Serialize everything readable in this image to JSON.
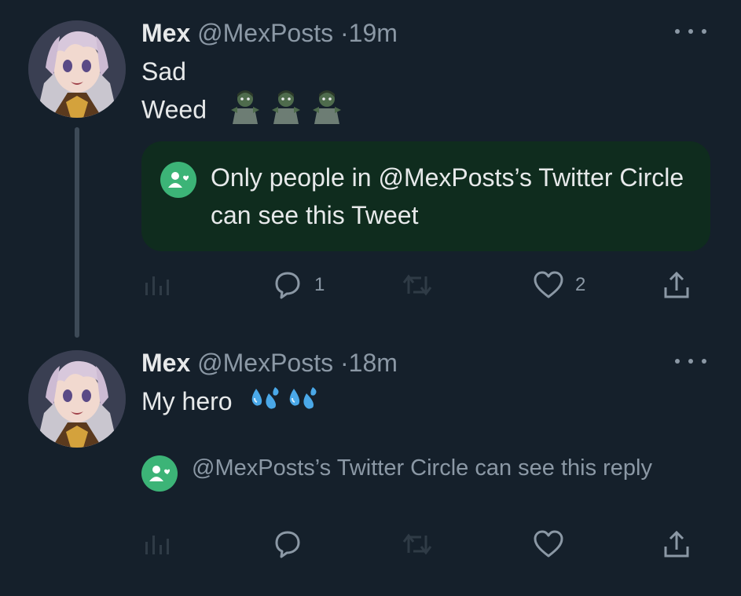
{
  "tweets": [
    {
      "name": "Mex",
      "handle": "@MexPosts",
      "separator": "·",
      "time": "19m",
      "lines": [
        "Sad",
        "Weed"
      ],
      "emoji": "zombie-emoji",
      "circle_notice": "Only people in @MexPosts’s Twitter Circle can see this Tweet",
      "actions": {
        "replies": "1",
        "retweets": "",
        "likes": "2"
      }
    },
    {
      "name": "Mex",
      "handle": "@MexPosts",
      "separator": "·",
      "time": "18m",
      "text": "My hero",
      "emoji": "sweat-droplets-emoji",
      "circle_notice": "@MexPosts’s Twitter Circle can see this reply",
      "actions": {
        "replies": "",
        "retweets": "",
        "likes": ""
      }
    }
  ],
  "colors": {
    "background": "#15202b",
    "secondary_text": "#8b98a5",
    "circle_green": "#3cb477",
    "circle_box_bg": "#0f2c1e"
  }
}
